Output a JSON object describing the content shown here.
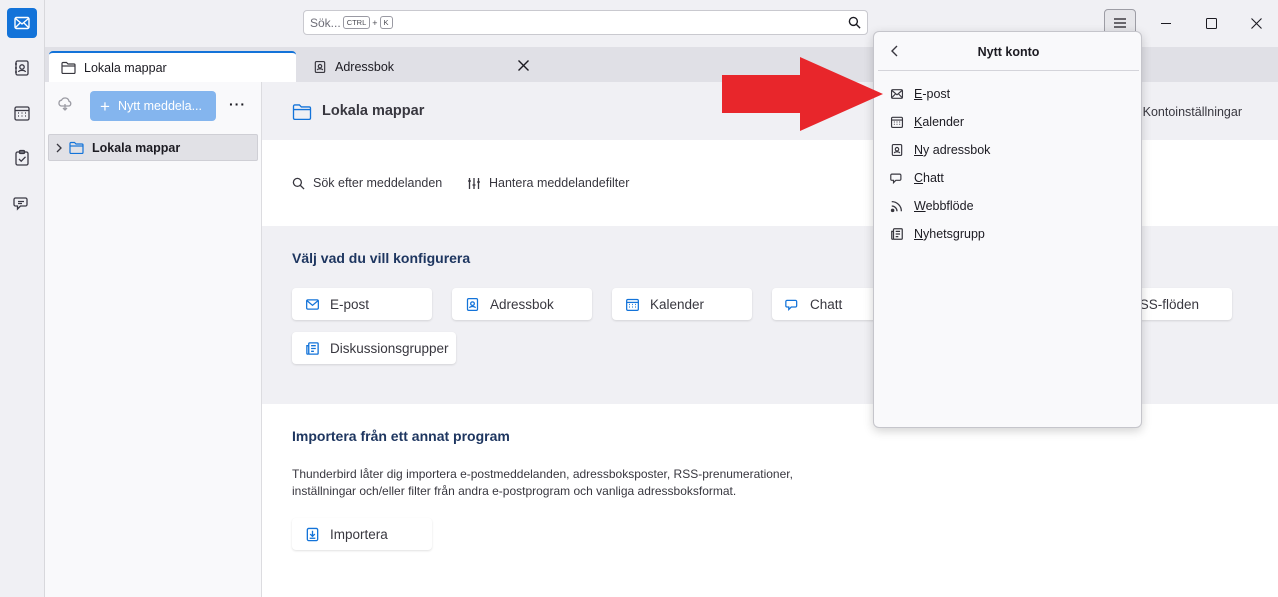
{
  "search": {
    "placeholder": "Sök...",
    "kbd_ctrl": "CTRL",
    "plus": "+",
    "kbd_k": "K"
  },
  "tabs": [
    {
      "label": "Lokala mappar",
      "icon": "folder-icon"
    },
    {
      "label": "Adressbok",
      "icon": "addressbook-icon"
    }
  ],
  "folderpane": {
    "new_message": "Nytt meddela...",
    "more": "···",
    "folder": "Lokala mappar"
  },
  "main": {
    "header_title": "Lokala mappar",
    "account_settings": "Kontoinställningar",
    "action_search": "Sök efter meddelanden",
    "action_filters": "Hantera meddelandefilter",
    "configure_title": "Välj vad du vill konfigurera",
    "cards": [
      {
        "label": "E-post",
        "icon": "mail-icon"
      },
      {
        "label": "Adressbok",
        "icon": "addressbook-icon"
      },
      {
        "label": "Kalender",
        "icon": "calendar-icon"
      },
      {
        "label": "Chatt",
        "icon": "chat-icon"
      },
      {
        "label": "RSS-flöden",
        "icon": "rss-icon"
      },
      {
        "label": "Diskussionsgrupper",
        "icon": "newsgroup-icon"
      }
    ],
    "import_title": "Importera från ett annat program",
    "import_desc_line1": "Thunderbird låter dig importera e-postmeddelanden, adressboksposter, RSS-prenumerationer,",
    "import_desc_line2": "inställningar och/eller filter från andra e-postprogram och vanliga adressboksformat.",
    "import_button": "Importera"
  },
  "popup": {
    "title": "Nytt konto",
    "items": [
      {
        "label": "E-post",
        "icon": "mail-icon"
      },
      {
        "label": "Kalender",
        "icon": "calendar-icon"
      },
      {
        "label": "Ny adressbok",
        "icon": "addressbook-icon"
      },
      {
        "label": "Chatt",
        "icon": "chat-icon"
      },
      {
        "label": "Webbflöde",
        "icon": "rss-icon"
      },
      {
        "label": "Nyhetsgrupp",
        "icon": "newsgroup-icon"
      }
    ]
  },
  "colors": {
    "accent": "#1373d9",
    "arrow": "#e8262b"
  }
}
